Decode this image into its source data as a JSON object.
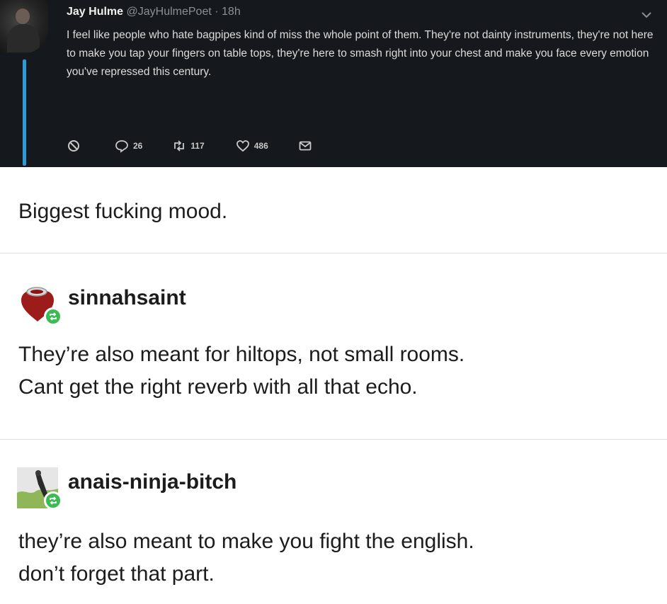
{
  "tweet": {
    "name": "Jay Hulme",
    "handle": "@JayHulmePoet",
    "separator": "·",
    "time": "18h",
    "text": "I feel like people who hate bagpipes kind of miss the whole point of them. They're not dainty instruments, they're not here to make you tap your fingers on table tops, they're here to smash right into your chest and make you face every emotion you've repressed this century.",
    "reply_count": "26",
    "retweet_count": "117",
    "like_count": "486",
    "accent_color": "#2f9bd6",
    "icons": [
      "block-icon",
      "reply-icon",
      "retweet-icon",
      "like-icon",
      "dm-icon",
      "chevron-down-icon"
    ]
  },
  "first_comment": "Biggest fucking mood.",
  "replies": [
    {
      "username": "sinnahsaint",
      "lines": [
        "They’re also meant for hiltops, not small rooms.",
        "Cant get the right reverb with all that echo."
      ]
    },
    {
      "username": "anais-ninja-bitch",
      "lines": [
        "they’re also meant to make you fight the english.",
        "don’t forget that part."
      ]
    }
  ],
  "reblog_color": "#3cba54"
}
